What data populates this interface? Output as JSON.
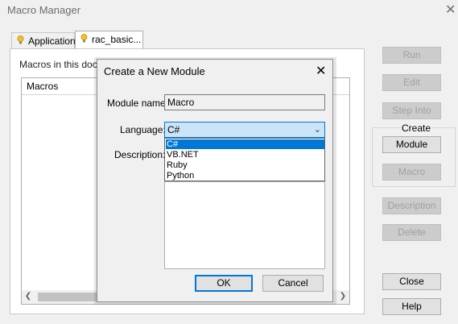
{
  "window": {
    "title": "Macro Manager"
  },
  "tabs": [
    {
      "label": "Application",
      "icon": "bulb-icon"
    },
    {
      "label": "rac_basic...",
      "icon": "bulb-icon"
    }
  ],
  "panel": {
    "label": "Macros in this docu",
    "list_header": "Macros"
  },
  "right_buttons": {
    "run": "Run",
    "edit": "Edit",
    "step_into": "Step Into",
    "create_group": "Create",
    "module": "Module",
    "macro": "Macro",
    "description": "Description",
    "delete": "Delete",
    "close": "Close",
    "help": "Help"
  },
  "dialog": {
    "title": "Create a New Module",
    "module_name_label": "Module name:",
    "module_name_value": "Macro",
    "language_label": "Language:",
    "language_selected": "C#",
    "language_options": [
      "C#",
      "VB.NET",
      "Ruby",
      "Python"
    ],
    "description_label": "Description:",
    "description_value": "",
    "ok": "OK",
    "cancel": "Cancel"
  },
  "colors": {
    "accent": "#0078d7",
    "selection_bg": "#cce4f7"
  }
}
